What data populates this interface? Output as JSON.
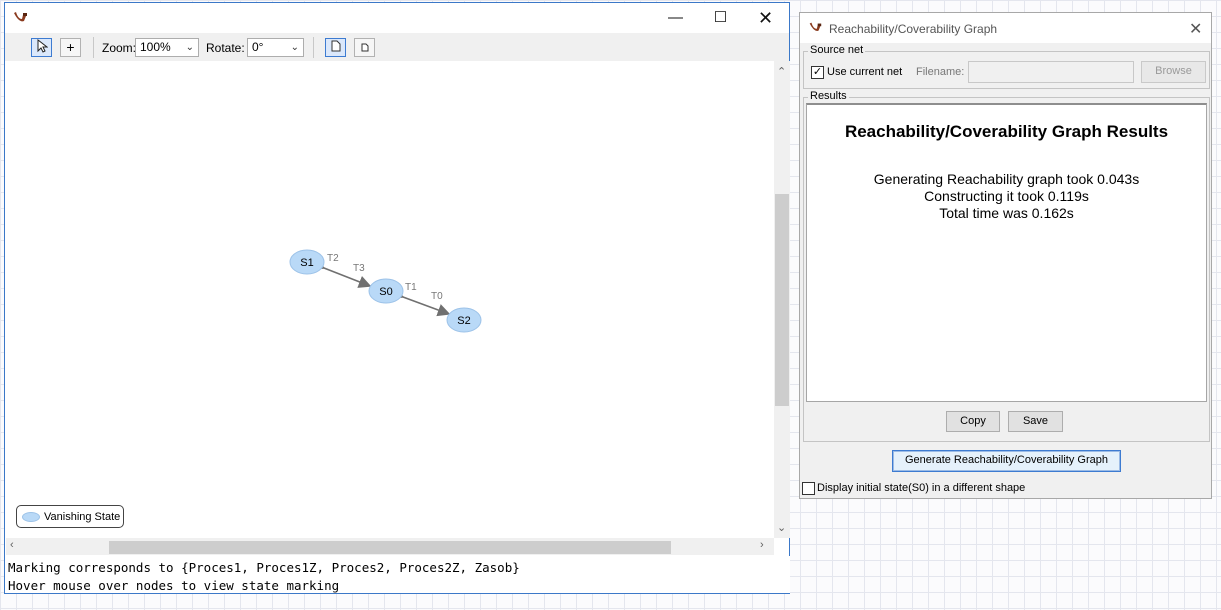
{
  "graph_window": {
    "toolbar": {
      "zoom_label": "Zoom:",
      "zoom_value": "100%",
      "rotate_label": "Rotate:",
      "rotate_value": "0°"
    },
    "nodes": [
      {
        "id": "S1",
        "label": "S1"
      },
      {
        "id": "S0",
        "label": "S0"
      },
      {
        "id": "S2",
        "label": "S2"
      }
    ],
    "edge_labels": [
      "T2",
      "T3",
      "T1",
      "T0"
    ],
    "legend_label": "Vanishing State",
    "status_line_1": "Marking corresponds to {Proces1, Proces1Z, Proces2, Proces2Z, Zasob}",
    "status_line_2": "Hover mouse over nodes to view state marking",
    "colors": {
      "node_fill": "#b9d9f7",
      "node_stroke": "#9cc2e8",
      "edge": "#707070"
    }
  },
  "results_window": {
    "title": "Reachability/Coverability Graph",
    "source_net": {
      "group_label": "Source net",
      "use_current_net_label": "Use current net",
      "use_current_net_checked": true,
      "filename_label": "Filename:",
      "filename_value": "",
      "browse_label": "Browse"
    },
    "results": {
      "group_label": "Results",
      "heading": "Reachability/Coverability Graph Results",
      "lines": [
        "Generating Reachability graph took 0.043s",
        "Constructing it took 0.119s",
        "Total time was 0.162s"
      ],
      "copy_label": "Copy",
      "save_label": "Save"
    },
    "generate_label": "Generate Reachability/Coverability Graph",
    "initial_state_checkbox_label": "Display initial state(S0) in a different shape",
    "initial_state_checked": false
  }
}
